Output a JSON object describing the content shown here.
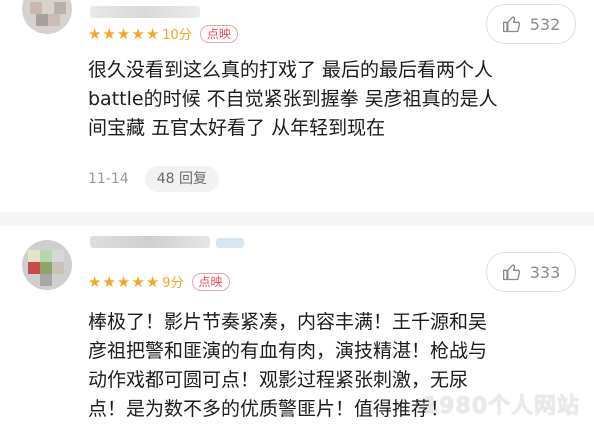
{
  "comments": [
    {
      "score_text": "10分",
      "badge": "点映",
      "likes": "532",
      "text": "很久没看到这么真的打戏了 最后的最后看两个人\nbattle的时候 不自觉紧张到握拳 吴彦祖真的是人\n间宝藏 五官太好看了 从年轻到现在",
      "date": "11-14",
      "replies": "48 回复",
      "stars": [
        "★",
        "★",
        "★",
        "★",
        "★"
      ]
    },
    {
      "score_text": "9分",
      "badge": "点映",
      "likes": "333",
      "text": "棒极了！影片节奏紧凑，内容丰满！王千源和吴\n彦祖把警和匪演的有血有肉，演技精湛！枪战与\n动作戏都可圆可点！观影过程紧张刺激，无尿\n点！是为数不多的优质警匪片！值得推荐！",
      "stars": [
        "★",
        "★",
        "★",
        "★",
        "★"
      ]
    }
  ],
  "watermark": "1980个人网站",
  "colors": {
    "star": "#f5a623",
    "badge": "#e8505b",
    "date": "#999999"
  },
  "icons": {
    "like": "thumbs-up-icon"
  }
}
